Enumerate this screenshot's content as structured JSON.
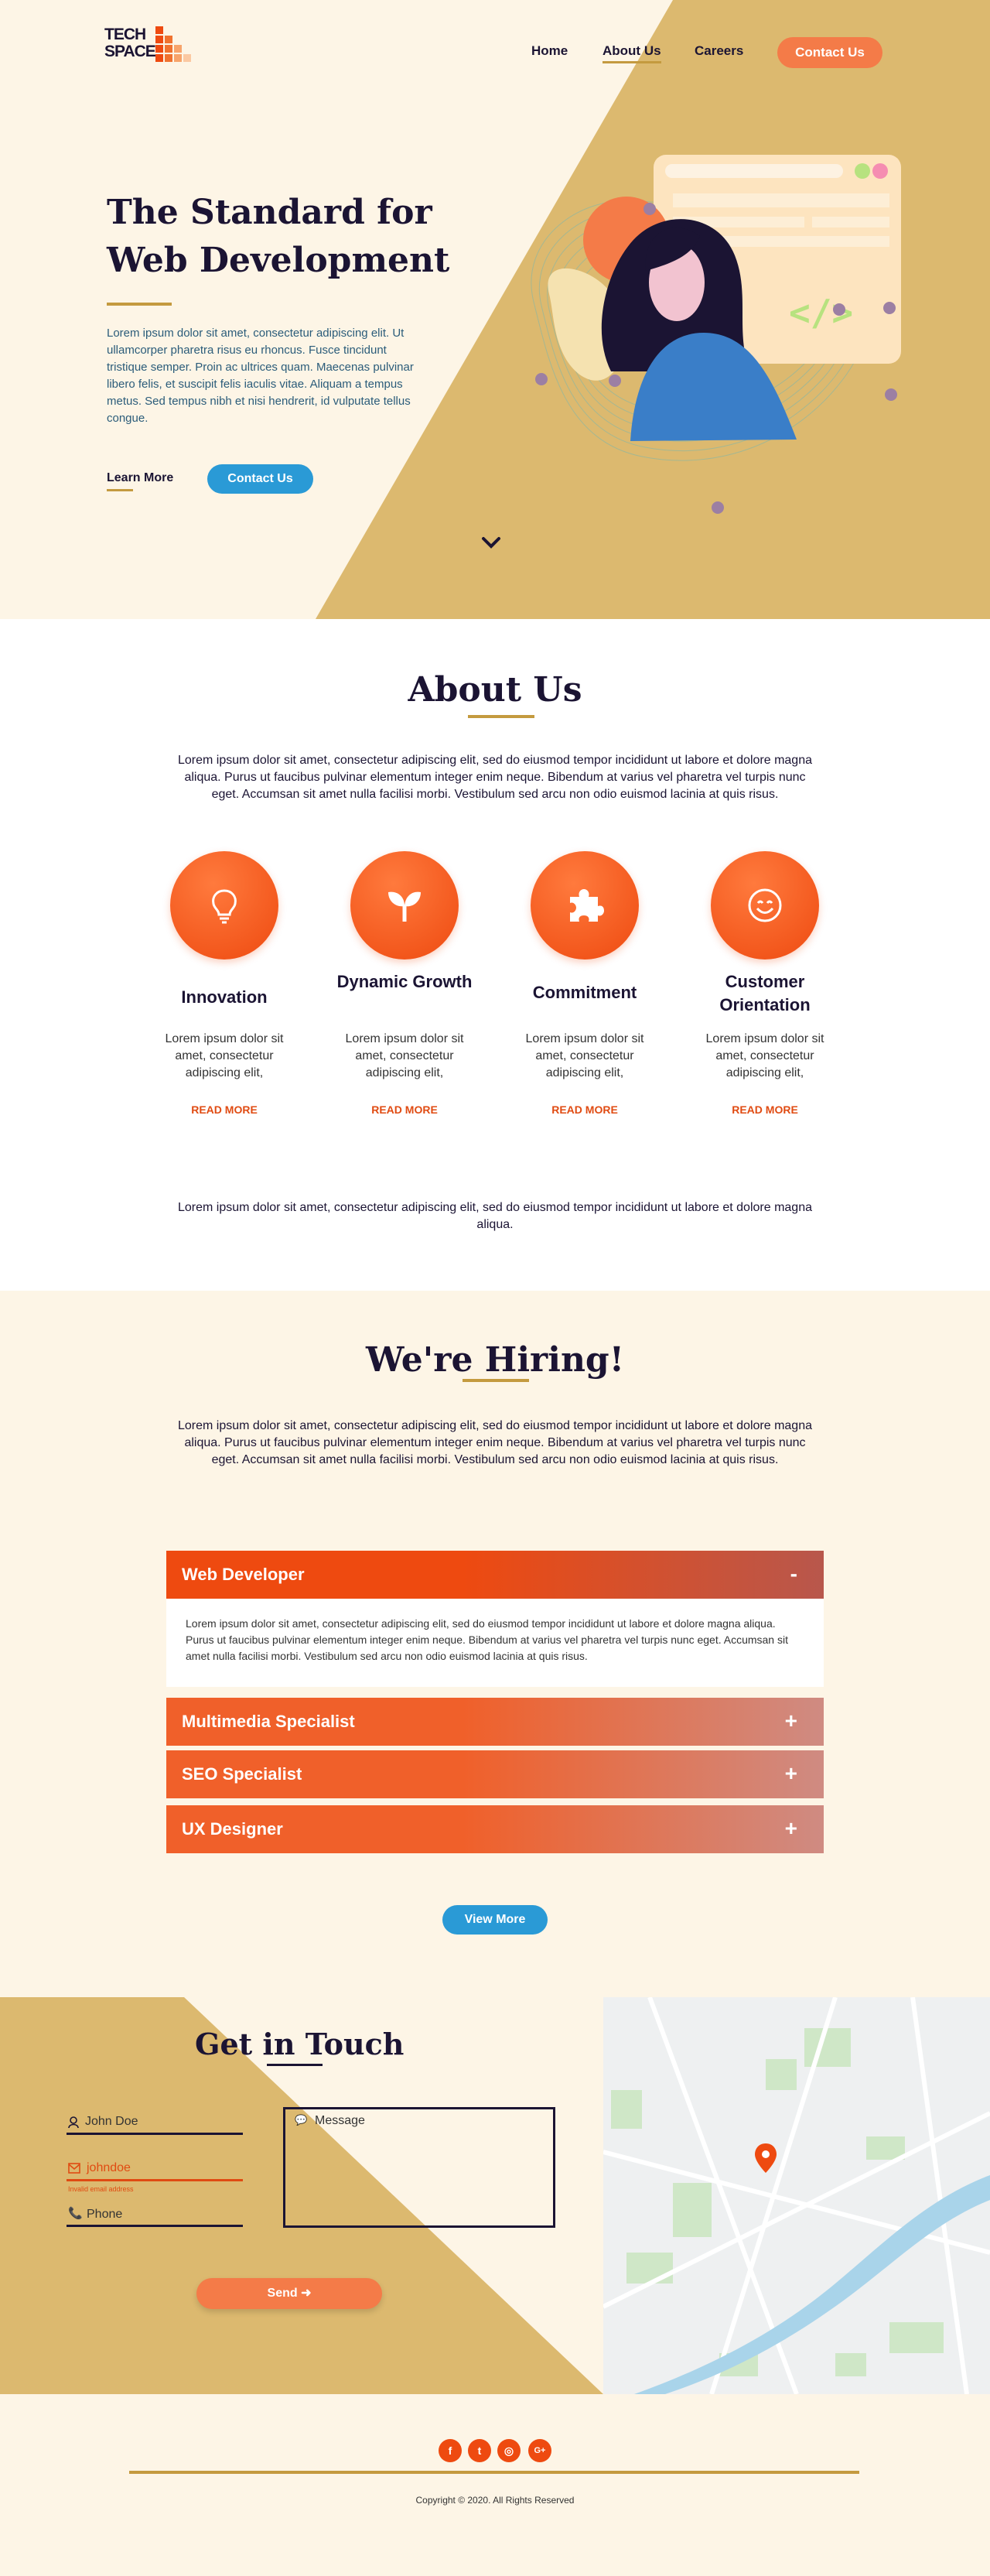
{
  "header": {
    "logo_line1": "TECH",
    "logo_line2": "SPACE",
    "nav": [
      "Home",
      "About Us",
      "Careers"
    ],
    "contact_button": "Contact Us"
  },
  "hero": {
    "title_line1": "The Standard for",
    "title_line2": "Web Development",
    "text": "Lorem ipsum dolor sit amet, consectetur adipiscing elit. Ut ullamcorper pharetra risus eu rhoncus. Fusce tincidunt tristique semper. Proin ac ultrices quam. Maecenas pulvinar libero felis, et suscipit felis iaculis vitae. Aliquam a tempus metus. Sed tempus nibh et nisi hendrerit, id vulputate tellus congue.",
    "learn_more": "Learn More",
    "contact_button": "Contact Us",
    "illustration_code": "</>"
  },
  "about": {
    "title": "About Us",
    "intro": "Lorem ipsum dolor sit amet, consectetur adipiscing elit, sed do eiusmod tempor incididunt ut labore et dolore magna aliqua. Purus ut faucibus pulvinar elementum integer enim neque. Bibendum at varius vel pharetra vel turpis nunc eget. Accumsan sit amet nulla facilisi morbi. Vestibulum sed arcu non odio euismod lacinia at quis risus.",
    "features": [
      {
        "icon": "lightbulb-icon",
        "title": "Innovation",
        "text": "Lorem ipsum dolor sit amet, consectetur adipiscing elit,",
        "link": "READ MORE"
      },
      {
        "icon": "sprout-icon",
        "title": "Dynamic Growth",
        "text": "Lorem ipsum dolor sit amet, consectetur adipiscing elit,",
        "link": "READ MORE"
      },
      {
        "icon": "puzzle-icon",
        "title": "Commitment",
        "text": "Lorem ipsum dolor sit amet, consectetur adipiscing elit,",
        "link": "READ MORE"
      },
      {
        "icon": "smiley-icon",
        "title": "Customer Orientation",
        "text": "Lorem ipsum dolor sit amet, consectetur adipiscing elit,",
        "link": "READ MORE"
      }
    ],
    "outro": "Lorem ipsum dolor sit amet, consectetur adipiscing elit, sed do eiusmod tempor incididunt ut labore et dolore magna aliqua."
  },
  "hiring": {
    "title": "We're Hiring!",
    "intro": "Lorem ipsum dolor sit amet, consectetur adipiscing elit, sed do eiusmod tempor incididunt ut labore et dolore magna aliqua. Purus ut faucibus pulvinar elementum integer enim neque. Bibendum at varius vel pharetra vel turpis nunc eget. Accumsan sit amet nulla facilisi morbi. Vestibulum sed arcu non odio euismod lacinia at quis risus.",
    "jobs": [
      {
        "title": "Web Developer",
        "sign": "-",
        "expanded": true,
        "body": "Lorem ipsum dolor sit amet, consectetur adipiscing elit, sed do eiusmod tempor incididunt ut labore et dolore magna aliqua. Purus ut faucibus pulvinar elementum integer enim neque. Bibendum at varius vel pharetra vel turpis nunc eget. Accumsan sit amet nulla facilisi morbi. Vestibulum sed arcu non odio euismod lacinia at quis risus."
      },
      {
        "title": "Multimedia Specialist",
        "sign": "+",
        "expanded": false
      },
      {
        "title": "SEO Specialist",
        "sign": "+",
        "expanded": false
      },
      {
        "title": "UX Designer",
        "sign": "+",
        "expanded": false
      }
    ],
    "view_more": "View More"
  },
  "contact": {
    "title": "Get in Touch",
    "name_placeholder": "John Doe",
    "email_value": "johndoe",
    "email_error": "Invalid email address",
    "phone_placeholder": "Phone",
    "message_placeholder": "Message",
    "send_button": "Send ➜"
  },
  "footer": {
    "social": [
      "f",
      "t",
      "◎",
      "G+"
    ],
    "copyright": "Copyright © 2020. All Rights Reserved"
  },
  "colors": {
    "gold": "#dcb96f",
    "cream": "#fdf5e6",
    "orange": "#ee4a10",
    "navy": "#1b1433",
    "blue": "#2a9ad6"
  }
}
